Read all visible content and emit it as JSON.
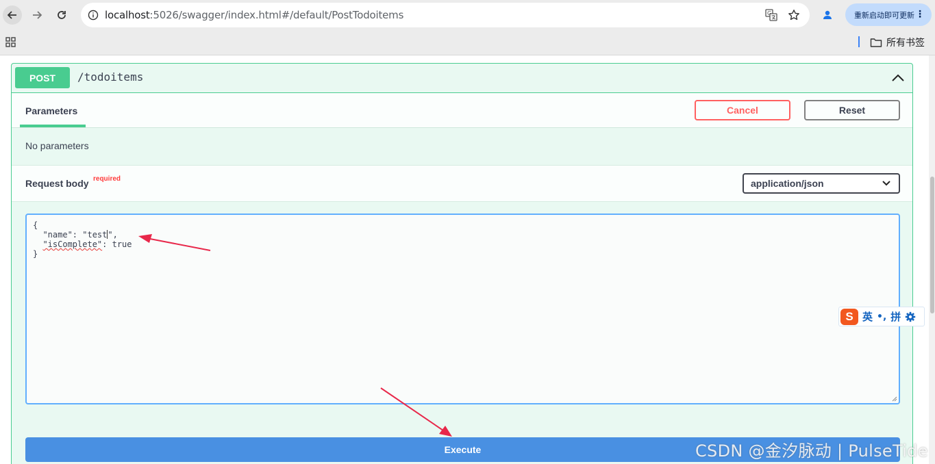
{
  "browser": {
    "url_host": "localhost",
    "url_rest": ":5026/swagger/index.html#/default/PostTodoitems",
    "update_button_label": "重新启动即可更新",
    "all_bookmarks_label": "所有书签",
    "icons": [
      "back-arrow-icon",
      "forward-arrow-icon",
      "reload-icon",
      "site-info-icon",
      "translate-icon",
      "star-icon",
      "profile-icon",
      "more-vert-icon",
      "apps-grid-icon",
      "folder-icon"
    ]
  },
  "operation": {
    "method": "POST",
    "path": "/todoitems",
    "method_color": "#49cc90"
  },
  "parameters": {
    "tab_label": "Parameters",
    "cancel_label": "Cancel",
    "reset_label": "Reset",
    "no_params_text": "No parameters"
  },
  "request_body": {
    "label": "Request body",
    "required_label": "required",
    "content_type": "application/json",
    "json_lines": [
      "{",
      "  \"name\": \"test\",",
      "  \"isComplete\": true",
      "}"
    ]
  },
  "execute": {
    "label": "Execute",
    "color": "#4990e2"
  },
  "ime": {
    "logo": "S",
    "mode": "英",
    "punctuation": "•,",
    "input_type": "拼"
  },
  "watermark": "CSDN @金汐脉动 | PulseTide"
}
